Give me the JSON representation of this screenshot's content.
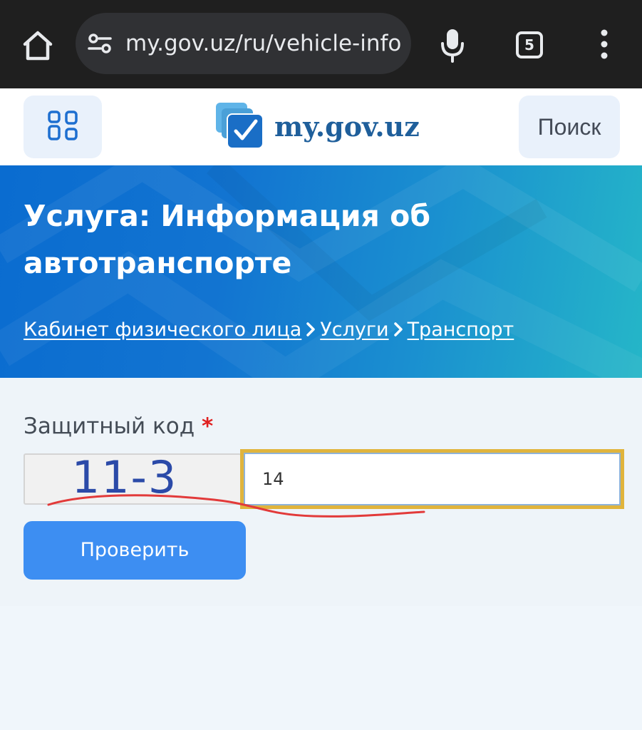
{
  "browser": {
    "url": "my.gov.uz/ru/vehicle-info",
    "tab_count": "5",
    "icons": {
      "home": "home-icon",
      "site_settings": "tune-icon",
      "mic": "microphone-icon",
      "tabs": "tabs-icon",
      "more": "more-vert-icon"
    }
  },
  "header": {
    "logo_text": "my.gov.uz",
    "search_label": "Поиск",
    "menu_icon": "grid-menu-icon"
  },
  "hero": {
    "title": "Услуга: Информация об автотранспорте",
    "breadcrumbs": [
      {
        "label": "Кабинет физического лица"
      },
      {
        "label": "Услуги"
      },
      {
        "label": "Транспорт"
      }
    ]
  },
  "form": {
    "captcha_label": "Защитный код",
    "required_mark": "*",
    "captcha_expression": "11-3",
    "answer_value": "14",
    "submit_label": "Проверить"
  },
  "colors": {
    "chrome_bg": "#1f1f1f",
    "brand_blue": "#1f5f9b",
    "button_blue": "#3d8ef2",
    "input_focus": "#e0b43c",
    "required": "#e02020"
  }
}
